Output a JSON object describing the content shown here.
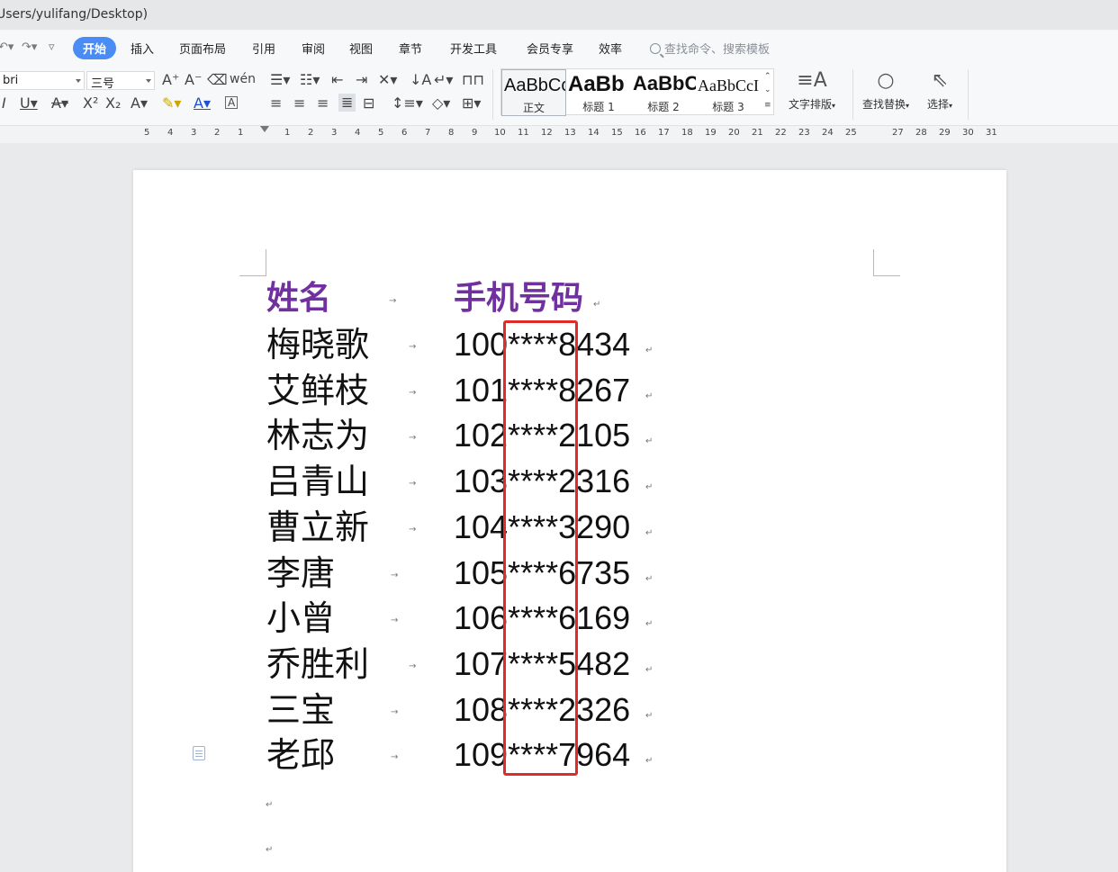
{
  "window": {
    "path": "Users/yulifang/Desktop)"
  },
  "menu": {
    "tabs": [
      "开始",
      "插入",
      "页面布局",
      "引用",
      "审阅",
      "视图",
      "章节",
      "开发工具",
      "会员专享",
      "效率"
    ],
    "search_placeholder": "查找命令、搜索模板"
  },
  "ribbon": {
    "font_name": "bri",
    "font_size": "三号",
    "styles": [
      {
        "sample": "AaBbCcDd",
        "label": "正文"
      },
      {
        "sample": "AaBb",
        "label": "标题 1"
      },
      {
        "sample": "AaBbC",
        "label": "标题 2"
      },
      {
        "sample": "AaBbCcI",
        "label": "标题 3"
      }
    ],
    "text_layout_label": "文字排版",
    "find_replace_label": "查找替换",
    "select_label": "选择"
  },
  "ruler": [
    "5",
    "4",
    "3",
    "2",
    "1",
    "1",
    "2",
    "3",
    "4",
    "5",
    "6",
    "7",
    "8",
    "9",
    "10",
    "11",
    "12",
    "13",
    "14",
    "15",
    "16",
    "17",
    "18",
    "19",
    "20",
    "21",
    "22",
    "23",
    "24",
    "25",
    "27",
    "28",
    "29",
    "30",
    "31"
  ],
  "document": {
    "header": {
      "name": "姓名",
      "phone": "手机号码"
    },
    "rows": [
      {
        "name": "梅晓歌",
        "phone": "100****8434"
      },
      {
        "name": "艾鲜枝",
        "phone": "101****8267"
      },
      {
        "name": "林志为",
        "phone": "102****2105"
      },
      {
        "name": "吕青山",
        "phone": "103****2316"
      },
      {
        "name": "曹立新",
        "phone": "104****3290"
      },
      {
        "name": "李唐",
        "phone": "105****6735"
      },
      {
        "name": "小曾",
        "phone": "106****6169"
      },
      {
        "name": "乔胜利",
        "phone": "107****5482"
      },
      {
        "name": "三宝",
        "phone": "108****2326"
      },
      {
        "name": "老邱",
        "phone": "109****7964"
      }
    ],
    "tab_mark": "→",
    "para_mark": "↵",
    "highlight_color": "#e02b2b",
    "header_color": "#7030a0"
  }
}
